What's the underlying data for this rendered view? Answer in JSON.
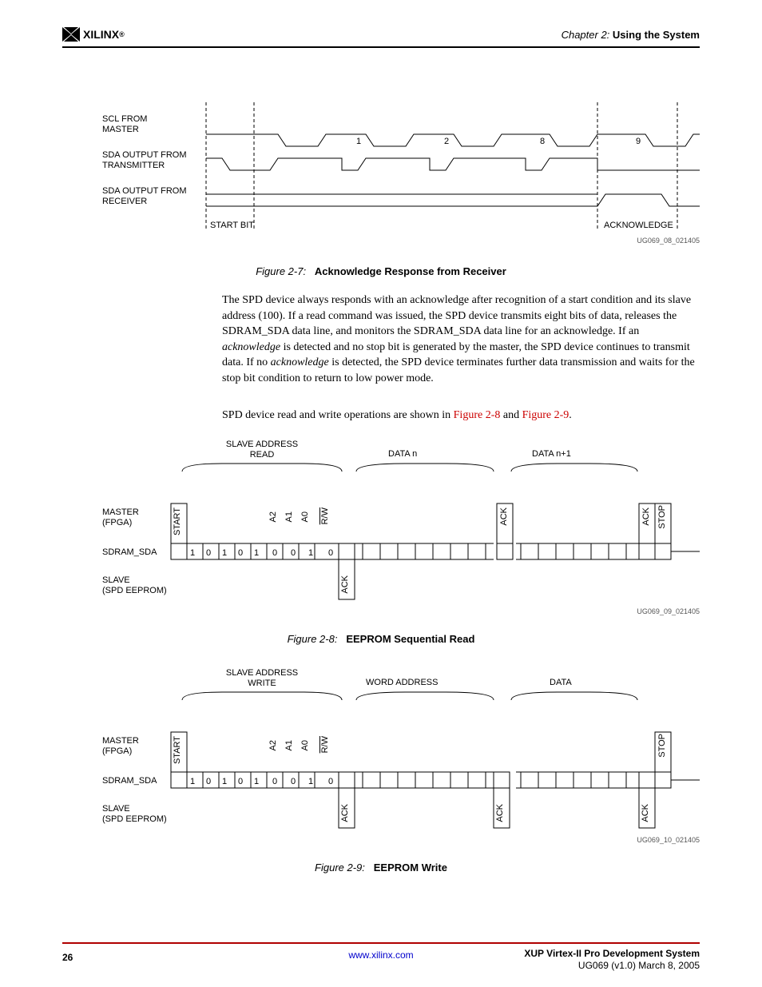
{
  "header": {
    "chapter_prefix": "Chapter 2:",
    "chapter_title": "Using the System",
    "logo_text": "XILINX",
    "logo_reg": "®"
  },
  "figure7": {
    "labels": {
      "scl": "SCL FROM\nMASTER",
      "sda_tx": "SDA OUTPUT FROM\nTRANSMITTER",
      "sda_rx": "SDA OUTPUT FROM\nRECEIVER",
      "start": "START BIT",
      "ack": "ACKNOWLEDGE",
      "bits": [
        "1",
        "2",
        "8",
        "9"
      ]
    },
    "id": "UG069_08_021405",
    "caption_num": "Figure 2-7:",
    "caption_title": "Acknowledge Response from Receiver"
  },
  "body": {
    "para1": "The SPD device always responds with an acknowledge after recognition of a start condition and its slave address (100). If a read command was issued, the SPD device transmits eight bits of data, releases the SDRAM_SDA data line, and monitors the SDRAM_SDA data line for an acknowledge. If an ",
    "para1_em": "acknowledge",
    "para1_cont": " is detected and no stop bit is generated by the master, the SPD device continues to transmit data. If no ",
    "para1_em2": "acknowledge",
    "para1_cont2": " is detected, the SPD device terminates further data transmission and waits for the stop bit condition to return to low power mode.",
    "para2_a": "SPD device read and write operations are shown in ",
    "para2_x1": "Figure 2-8",
    "para2_b": " and ",
    "para2_x2": "Figure 2-9",
    "para2_c": "."
  },
  "figure8": {
    "top_labels": {
      "slave_addr": "SLAVE ADDRESS\nREAD",
      "data_n": "DATA n",
      "data_n1": "DATA n+1"
    },
    "row_labels": {
      "master": "MASTER\n(FPGA)",
      "sda": "SDRAM_SDA",
      "slave": "SLAVE\n(SPD EEPROM)"
    },
    "v_labels": {
      "start": "START",
      "a2": "A2",
      "a1": "A1",
      "a0": "A0",
      "rw": "R/W",
      "ack": "ACK",
      "stop": "STOP"
    },
    "bits": [
      "1",
      "0",
      "1",
      "0",
      "1",
      "0",
      "0",
      "1",
      "0"
    ],
    "id": "UG069_09_021405",
    "caption_num": "Figure 2-8:",
    "caption_title": "EEPROM Sequential Read"
  },
  "figure9": {
    "top_labels": {
      "slave_addr": "SLAVE ADDRESS\nWRITE",
      "word": "WORD ADDRESS",
      "data": "DATA"
    },
    "row_labels": {
      "master": "MASTER\n(FPGA)",
      "sda": "SDRAM_SDA",
      "slave": "SLAVE\n(SPD EEPROM)"
    },
    "v_labels": {
      "start": "START",
      "a2": "A2",
      "a1": "A1",
      "a0": "A0",
      "rw": "R/W",
      "ack": "ACK",
      "stop": "STOP"
    },
    "bits": [
      "1",
      "0",
      "1",
      "0",
      "1",
      "0",
      "0",
      "1",
      "0"
    ],
    "id": "UG069_10_021405",
    "caption_num": "Figure 2-9:",
    "caption_title": "EEPROM Write"
  },
  "footer": {
    "page": "26",
    "url": "www.xilinx.com",
    "title": "XUP  Virtex-II Pro Development System",
    "version": "UG069 (v1.0) March 8, 2005"
  }
}
